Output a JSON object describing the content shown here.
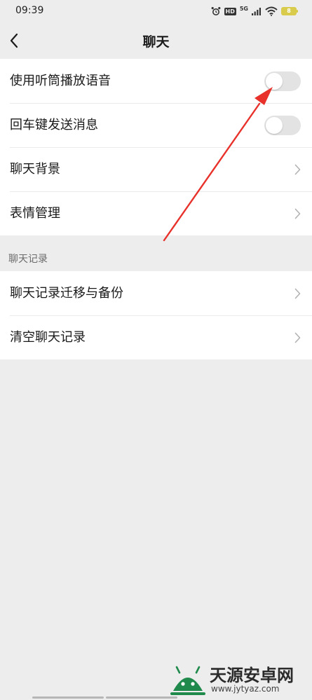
{
  "status_bar": {
    "time": "09:39",
    "network": "5G",
    "hd": "HD",
    "battery": "8"
  },
  "nav": {
    "title": "聊天"
  },
  "group_1": {
    "items": [
      {
        "label": "使用听筒播放语音",
        "control": "toggle",
        "on": false
      },
      {
        "label": "回车键发送消息",
        "control": "toggle",
        "on": false
      },
      {
        "label": "聊天背景",
        "control": "chevron"
      },
      {
        "label": "表情管理",
        "control": "chevron"
      }
    ]
  },
  "section_header": "聊天记录",
  "group_2": {
    "items": [
      {
        "label": "聊天记录迁移与备份",
        "control": "chevron"
      },
      {
        "label": "清空聊天记录",
        "control": "chevron"
      }
    ]
  },
  "watermark": {
    "title": "天源安卓网",
    "url": "www.jytyaz.com"
  },
  "colors": {
    "background": "#ededed",
    "cell": "#ffffff",
    "toggle_off": "#e3e3e3",
    "annotation_arrow": "#e8312a",
    "watermark_logo": "#1f8a4c"
  },
  "icons": {
    "back": "chevron-left-icon",
    "disclosure": "chevron-right-icon",
    "alarm": "alarm-icon",
    "wifi": "wifi-icon",
    "signal": "signal-icon",
    "battery": "battery-icon"
  }
}
